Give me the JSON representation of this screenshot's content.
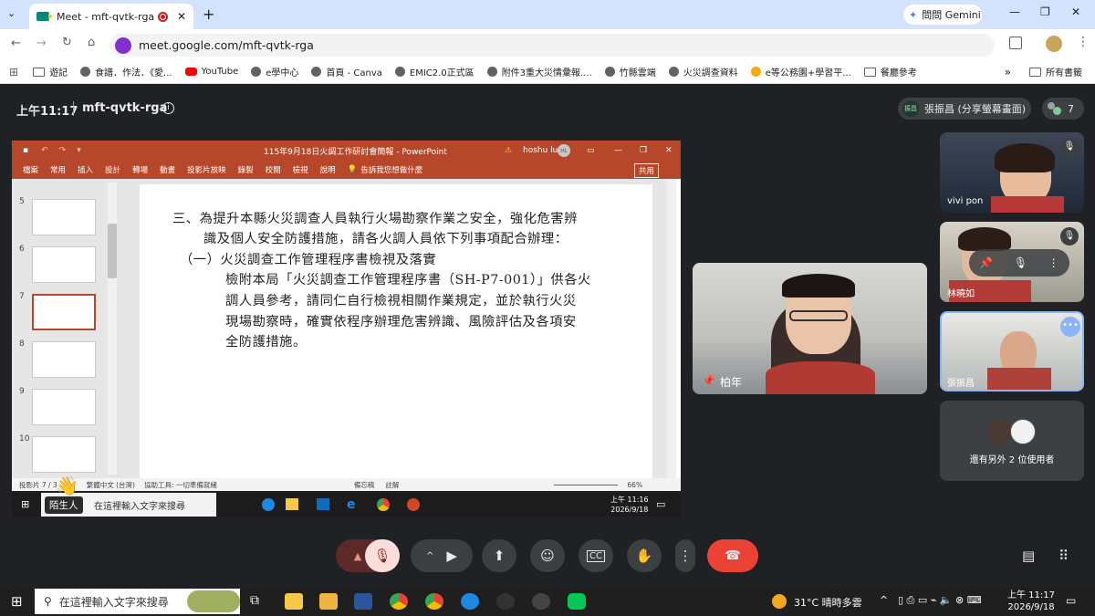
{
  "browser": {
    "tab_title": "Meet - mft-qvtk-rga",
    "url": "meet.google.com/mft-qvtk-rga",
    "gemini_label": "問問 Gemini",
    "bookmarks": [
      "遊記",
      "食譜．作法．《愛...",
      "YouTube",
      "e學中心",
      "首頁 - Canva",
      "EMIC2.0正式區",
      "附件3重大災情彙報....",
      "竹縣雲端",
      "火災調查資料",
      "e等公務園+學習平...",
      "餐廳參考"
    ],
    "all_bookmarks": "所有書籤"
  },
  "meet": {
    "time": "上午11:17",
    "code": "mft-qvtk-rga",
    "presenter_badge": "振昌",
    "presenter_label": "張振昌 (分享螢幕畫面)",
    "participant_count": "7",
    "main_speaker": "柏年",
    "tiles": [
      {
        "name": "vivi pon"
      },
      {
        "name": "林曉如"
      },
      {
        "name": "張振昌"
      },
      {
        "name": "還有另外 2 位使用者"
      }
    ],
    "stranger_label": "陌生人"
  },
  "ppt": {
    "title": "115年9月18日火調工作研討會簡報 - PowerPoint",
    "user": "hoshu lu",
    "user_initials": "HL",
    "tabs": [
      "檔案",
      "常用",
      "插入",
      "設計",
      "轉場",
      "動畫",
      "投影片放映",
      "錄製",
      "校閱",
      "檢視",
      "說明"
    ],
    "tellme": "告訴我您想做什麼",
    "share": "共用",
    "slide_numbers": [
      "5",
      "6",
      "7",
      "8",
      "9",
      "10"
    ],
    "lines": [
      "三、為提升本縣火災調查人員執行火場勘察作業之安全，強化危害辨",
      "識及個人安全防護措施，請各火調人員依下列事項配合辦理：",
      "（一）火災調查工作管理程序書檢視及落實",
      "檢附本局「火災調查工作管理程序書（SH-P7-001）」供各火",
      "調人員參考，請同仁自行檢視相關作業規定，並於執行火災",
      "現場勘察時，確實依程序辦理危害辨識、風險評估及各項安",
      "全防護措施。"
    ],
    "status_slide": "投影片 7 / 3",
    "status_lang": "繁體中文 (台灣)",
    "status_access": "協助工具: 一切準備就緒",
    "status_notes": "備忘稿",
    "status_comments": "註解",
    "zoom": "66%"
  },
  "inner_taskbar": {
    "search": "在這裡輸入文字來搜尋",
    "time": "上午 11:16",
    "date": "2026/9/18"
  },
  "taskbar": {
    "search": "在這裡輸入文字來搜尋",
    "weather": "31°C 晴時多雲",
    "time": "上午 11:17",
    "date": "2026/9/18"
  }
}
